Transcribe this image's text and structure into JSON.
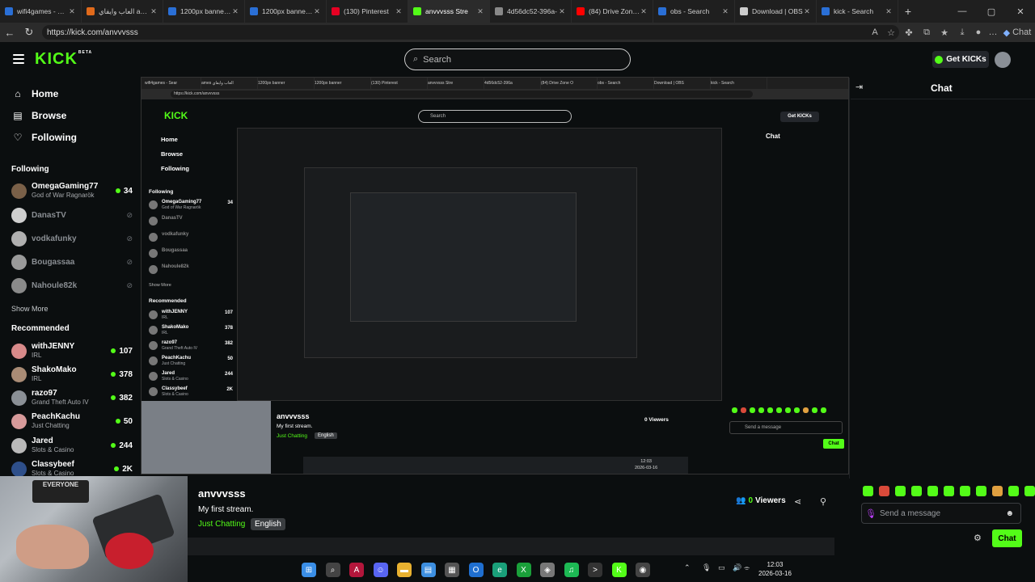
{
  "browser": {
    "tabs": [
      {
        "label": "wifi4games - Sear",
        "favicon": "search-icon",
        "color": "#2a6fd6"
      },
      {
        "label": "العاب وايفاي ames",
        "favicon": "game-icon",
        "color": "#e06a1b"
      },
      {
        "label": "1200px banner - S",
        "favicon": "search-icon",
        "color": "#2a6fd6"
      },
      {
        "label": "1200px banner - S",
        "favicon": "search-icon",
        "color": "#2a6fd6"
      },
      {
        "label": "(130) Pinterest",
        "favicon": "pinterest-icon",
        "color": "#e60023"
      },
      {
        "label": "anvvvsss Stre",
        "favicon": "kick-icon",
        "color": "#53fc18"
      },
      {
        "label": "4d56dc52-396a-",
        "favicon": "globe-icon",
        "color": "#888888"
      },
      {
        "label": "(84) Drive Zone O",
        "favicon": "youtube-icon",
        "color": "#ff0000"
      },
      {
        "label": "obs - Search",
        "favicon": "search-icon",
        "color": "#2a6fd6"
      },
      {
        "label": "Download | OBS",
        "favicon": "obs-icon",
        "color": "#cccccc"
      },
      {
        "label": "kick - Search",
        "favicon": "search-icon",
        "color": "#2a6fd6"
      }
    ],
    "active_tab": 5,
    "url": "https://kick.com/anvvvsss"
  },
  "header": {
    "logo_text": "KICK",
    "logo_badge": "BETA",
    "search_placeholder": "Search",
    "get_kicks_label": "Get KICKs"
  },
  "sidebar": {
    "nav": [
      {
        "label": "Home",
        "icon": "home-icon"
      },
      {
        "label": "Browse",
        "icon": "browse-icon"
      },
      {
        "label": "Following",
        "icon": "heart-icon"
      }
    ],
    "following_title": "Following",
    "following": [
      {
        "name": "OmegaGaming77",
        "category": "God of War Ragnarök",
        "viewers": "34",
        "live": true,
        "avatar_color": "#7a6048"
      },
      {
        "name": "DanasTV",
        "live": false,
        "avatar_color": "#cfcfcf"
      },
      {
        "name": "vodkafunky",
        "live": false,
        "avatar_color": "#b0b0b0"
      },
      {
        "name": "Bougassaa",
        "live": false,
        "avatar_color": "#9a9a9a"
      },
      {
        "name": "Nahoule82k",
        "live": false,
        "avatar_color": "#8a8a8a"
      }
    ],
    "show_more_label": "Show More",
    "recommended_title": "Recommended",
    "recommended": [
      {
        "name": "withJENNY",
        "category": "IRL",
        "viewers": "107",
        "avatar_color": "#d88a8a"
      },
      {
        "name": "ShakoMako",
        "category": "IRL",
        "viewers": "378",
        "avatar_color": "#a98b75"
      },
      {
        "name": "razo97",
        "category": "Grand Theft Auto IV",
        "viewers": "382",
        "avatar_color": "#8b9096"
      },
      {
        "name": "PeachKachu",
        "category": "Just Chatting",
        "viewers": "50",
        "avatar_color": "#d79a9a"
      },
      {
        "name": "Jared",
        "category": "Slots & Casino",
        "viewers": "244",
        "avatar_color": "#b9b9b9"
      },
      {
        "name": "Classybeef",
        "category": "Slots & Casino",
        "viewers": "2K",
        "avatar_color": "#2e4f8a"
      }
    ]
  },
  "stream": {
    "streamer": "anvvvsss",
    "title": "My first stream.",
    "category": "Just Chatting",
    "language": "English",
    "viewers": "0",
    "viewers_label": "Viewers",
    "video_poster_text": "EVERYONE"
  },
  "chat": {
    "title": "Chat",
    "placeholder": "Send a message",
    "send_label": "Chat",
    "emote_colors": [
      "#53fc18",
      "#d94a3a",
      "#53fc18",
      "#53fc18",
      "#53fc18",
      "#53fc18",
      "#53fc18",
      "#53fc18",
      "#e0a040",
      "#53fc18",
      "#53fc18"
    ]
  },
  "nested": {
    "url": "https://kick.com/anvvvsss",
    "tabs": [
      "wifi4games - Sear",
      "ames العاب وايفاي",
      "1200px banner",
      "1200px banner",
      "(130) Pinterest",
      "anvvvsss Stre",
      "4d56dc52-396a",
      "(84) Drive Zone O",
      "obs - Search",
      "Download | OBS",
      "kick - Search"
    ],
    "logo_text": "KICK",
    "search_placeholder": "Search",
    "get_kicks_label": "Get KICKs",
    "nav": [
      "Home",
      "Browse",
      "Following"
    ],
    "following_title": "Following",
    "following": [
      {
        "name": "OmegaGaming77",
        "category": "God of War Ragnarök",
        "viewers": "34"
      },
      {
        "name": "DanasTV"
      },
      {
        "name": "vodkafunky"
      },
      {
        "name": "Bougassaa"
      },
      {
        "name": "Nahoule82k"
      }
    ],
    "show_more_label": "Show More",
    "recommended_title": "Recommended",
    "recommended": [
      {
        "name": "withJENNY",
        "category": "IRL",
        "viewers": "107"
      },
      {
        "name": "ShakoMako",
        "category": "IRL",
        "viewers": "378"
      },
      {
        "name": "razo97",
        "category": "Grand Theft Auto IV",
        "viewers": "382"
      },
      {
        "name": "PeachKachu",
        "category": "Just Chatting",
        "viewers": "50"
      },
      {
        "name": "Jared",
        "category": "Slots & Casino",
        "viewers": "244"
      },
      {
        "name": "Classybeef",
        "category": "Slots & Casino",
        "viewers": "2K"
      }
    ],
    "streamer": "anvvvsss",
    "stream_title": "My first stream.",
    "category": "Just Chatting",
    "language": "English",
    "viewers": "0 Viewers",
    "chat_title": "Chat",
    "chat_placeholder": "Send a message",
    "chat_send": "Chat",
    "time": "12:03",
    "date": "2026-03-16"
  },
  "taskbar": {
    "apps": [
      {
        "icon": "windows-icon",
        "color": "#3a8ee6"
      },
      {
        "icon": "search-icon",
        "color": "#444444"
      },
      {
        "icon": "adobe-icon",
        "color": "#b3163b"
      },
      {
        "icon": "discord-icon",
        "color": "#5865f2"
      },
      {
        "icon": "folder-icon",
        "color": "#e8b130"
      },
      {
        "icon": "notepad-icon",
        "color": "#3d8fe0"
      },
      {
        "icon": "store-icon",
        "color": "#555555"
      },
      {
        "icon": "outlook-icon",
        "color": "#1f6fd0"
      },
      {
        "icon": "edge-icon",
        "color": "#1aa07a"
      },
      {
        "icon": "xbox-icon",
        "color": "#1aa03a"
      },
      {
        "icon": "app-icon",
        "color": "#777777"
      },
      {
        "icon": "spotify-icon",
        "color": "#1db954"
      },
      {
        "icon": "terminal-icon",
        "color": "#333333"
      },
      {
        "icon": "kick-icon",
        "color": "#53fc18"
      },
      {
        "icon": "obs-icon",
        "color": "#444444"
      }
    ],
    "time": "12:03",
    "date": "2026-03-16"
  }
}
